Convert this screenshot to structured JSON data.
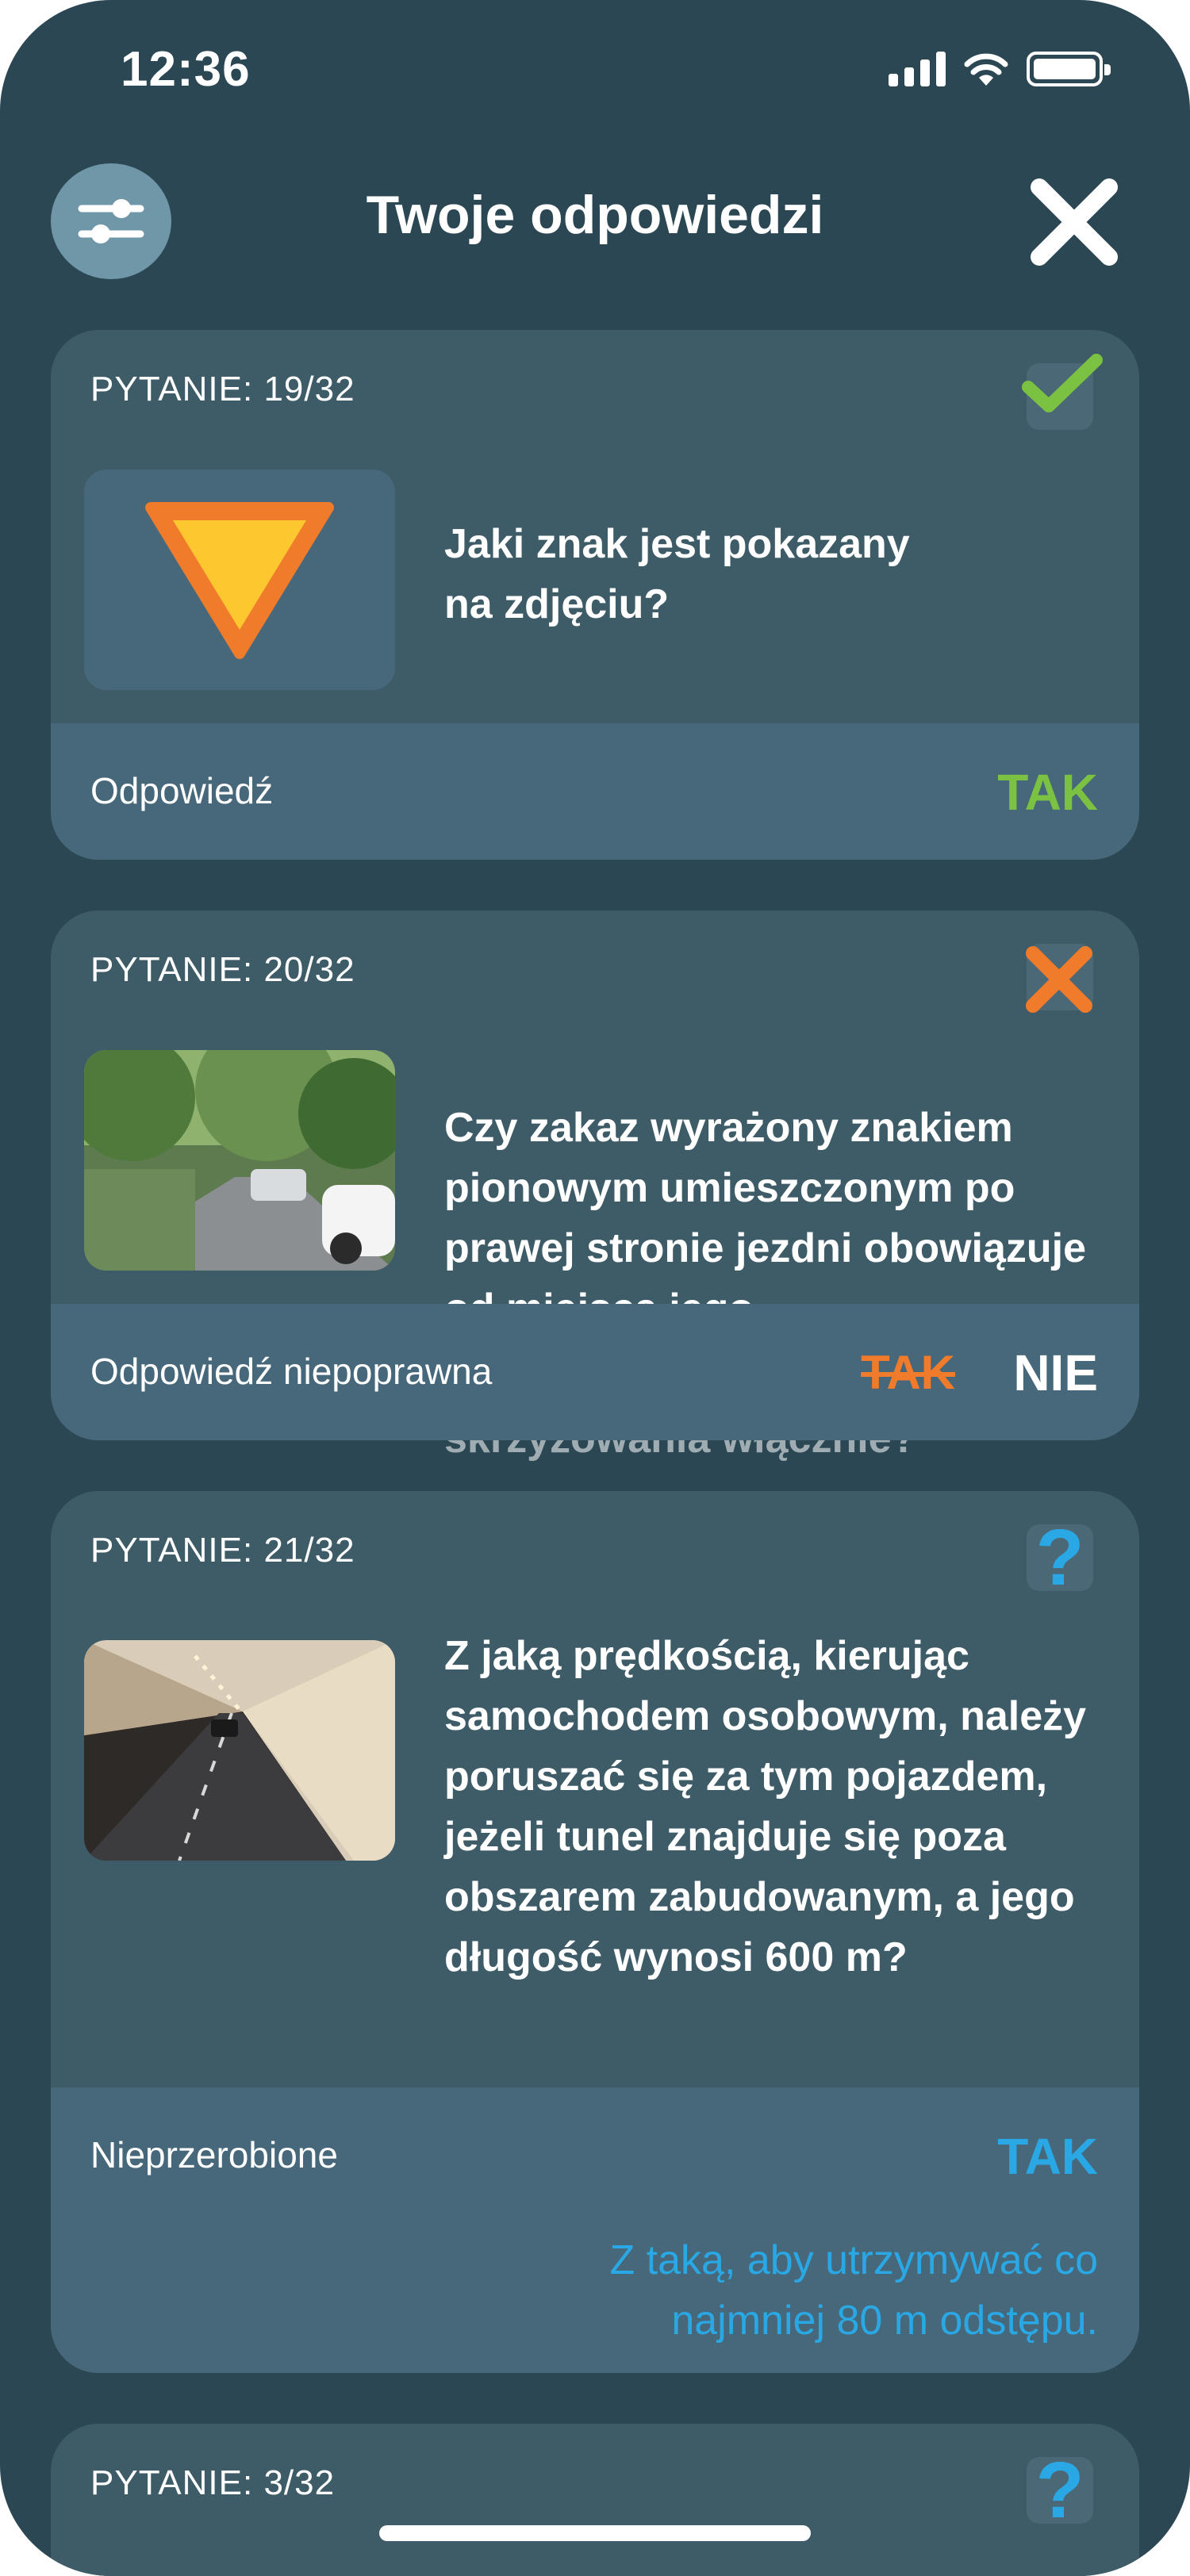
{
  "status_bar": {
    "time": "12:36"
  },
  "header": {
    "title": "Twoje odpowiedzi"
  },
  "colors": {
    "background": "#2a4753",
    "card": "#3e5b68",
    "answer_bar": "#47687a",
    "correct": "#7bc142",
    "wrong": "#f07b2b",
    "unanswered": "#29a8e5"
  },
  "cards": [
    {
      "label": "PYTANIE: 19/32",
      "status": "correct",
      "status_icon": "check-icon",
      "thumbnail": "yield-sign",
      "question": "Jaki znak jest pokazany na zdjęciu?",
      "answer_label": "Odpowiedź",
      "answer_value": "TAK"
    },
    {
      "label": "PYTANIE: 20/32",
      "status": "wrong",
      "status_icon": "cross-icon",
      "thumbnail": "street-photo",
      "question": "Czy zakaz wyrażony znakiem pionowym umieszczonym po prawej stronie jezdni obowiązuje od miejsca jego",
      "question_tail": "skrzyżowania włącznie?",
      "answer_label": "Odpowiedź niepoprawna",
      "answer_wrong": "TAK",
      "answer_value": "NIE"
    },
    {
      "label": "PYTANIE: 21/32",
      "status": "unanswered",
      "status_icon": "question-icon",
      "thumbnail": "tunnel-photo",
      "question": "Z jaką prędkością, kierując samochodem osobowym, należy poruszać się za tym pojazdem, jeżeli tunel znajduje się poza obszarem zabudowanym, a jego długość wynosi 600 m?",
      "answer_label": "Nieprzerobione",
      "answer_value": "TAK",
      "explanation": "Z taką, aby utrzymywać co najmniej 80 m odstępu."
    },
    {
      "label": "PYTANIE: 3/32",
      "status": "unanswered",
      "status_icon": "question-icon"
    }
  ]
}
